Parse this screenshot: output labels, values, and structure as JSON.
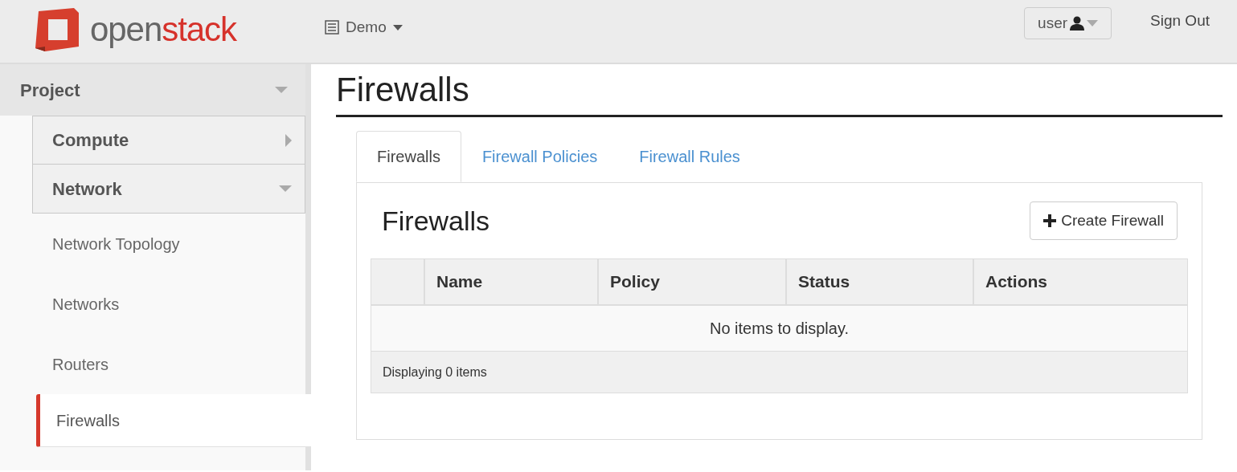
{
  "header": {
    "logo": {
      "text_1": "open",
      "text_2": "stack"
    },
    "project_menu": {
      "label": "Demo"
    },
    "user_menu": {
      "label": "user"
    },
    "sign_out": "Sign Out"
  },
  "sidebar": {
    "dashboard": {
      "label": "Project",
      "expanded": true
    },
    "panels": [
      {
        "label": "Compute",
        "expanded": false
      },
      {
        "label": "Network",
        "expanded": true,
        "items": [
          {
            "label": "Network Topology",
            "selected": false
          },
          {
            "label": "Networks",
            "selected": false
          },
          {
            "label": "Routers",
            "selected": false
          },
          {
            "label": "Firewalls",
            "selected": true
          }
        ]
      }
    ]
  },
  "page_title": "Firewalls",
  "tabs": [
    {
      "label": "Firewalls",
      "selected": true
    },
    {
      "label": "Firewall Policies",
      "selected": false
    },
    {
      "label": "Firewall Rules",
      "selected": false
    }
  ],
  "panel": {
    "title": "Firewalls",
    "create_button": "Create Firewall"
  },
  "table": {
    "columns": [
      "Name",
      "Policy",
      "Status",
      "Actions"
    ],
    "empty_message": "No items to display.",
    "footer": "Displaying 0 items"
  }
}
